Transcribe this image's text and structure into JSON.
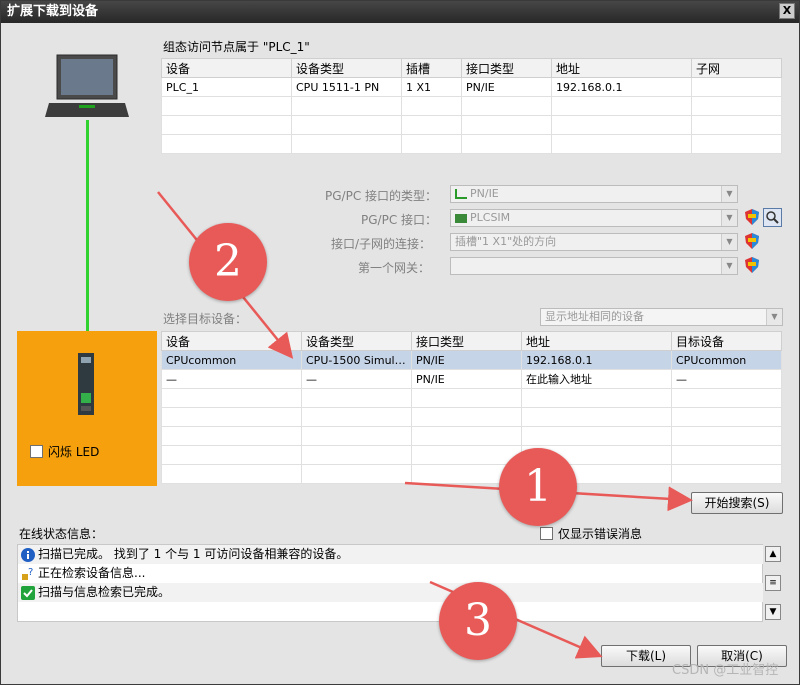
{
  "window": {
    "title": "扩展下载到设备",
    "close_label": "X"
  },
  "config_section": {
    "title": "组态访问节点属于 \"PLC_1\"",
    "columns": [
      "设备",
      "设备类型",
      "插槽",
      "接口类型",
      "地址",
      "子网"
    ],
    "rows": [
      [
        "PLC_1",
        "CPU 1511-1 PN",
        "1 X1",
        "PN/IE",
        "192.168.0.1",
        ""
      ]
    ]
  },
  "interface_settings": {
    "pgpc_type_label": "PG/PC 接口的类型：",
    "pgpc_type_value": "PN/IE",
    "pgpc_interface_label": "PG/PC 接口：",
    "pgpc_interface_value": "PLCSIM",
    "connection_label": "接口/子网的连接：",
    "connection_value": "插槽\"1 X1\"处的方向",
    "gateway_label": "第一个网关：",
    "gateway_value": ""
  },
  "target_section": {
    "label": "选择目标设备：",
    "filter_value": "显示地址相同的设备",
    "columns": [
      "设备",
      "设备类型",
      "接口类型",
      "地址",
      "目标设备"
    ],
    "rows": [
      [
        "CPUcommon",
        "CPU-1500 Simula...",
        "PN/IE",
        "192.168.0.1",
        "CPUcommon"
      ],
      [
        "—",
        "—",
        "PN/IE",
        "在此输入地址",
        "—"
      ]
    ]
  },
  "flash_led_label": "闪烁 LED",
  "search_button": "开始搜索(S)",
  "status_section": {
    "title": "在线状态信息：",
    "only_errors_label": "仅显示错误消息",
    "messages": [
      "扫描已完成。 找到了 1 个与 1 可访问设备相兼容的设备。",
      "正在检索设备信息...",
      "扫描与信息检索已完成。"
    ]
  },
  "buttons": {
    "download": "下载(L)",
    "cancel": "取消(C)"
  },
  "annotations": [
    "1",
    "2",
    "3"
  ],
  "watermark": "CSDN @工业智控",
  "colors": {
    "annotation": "#e85a58",
    "device_panel": "#f5a00c",
    "connection_line": "#2fd22f",
    "selected_row": "#c6d4e8"
  }
}
